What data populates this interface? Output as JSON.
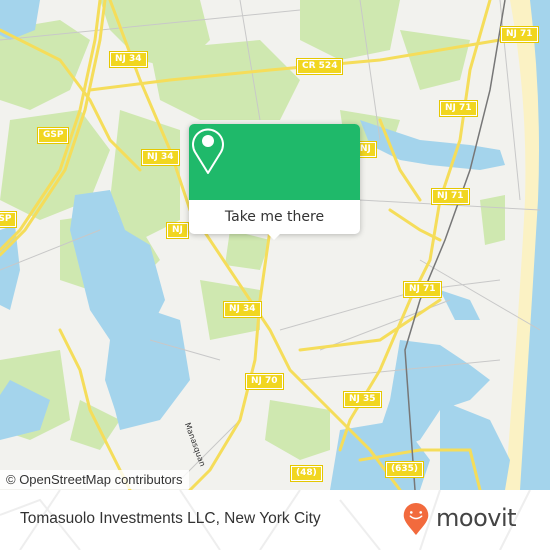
{
  "map": {
    "attribution": "© OpenStreetMap contributors",
    "colors": {
      "land": "#f2f2ee",
      "park": "#cfe8b0",
      "water": "#a4d4ec",
      "road_major": "#f5dd5a",
      "beach": "#fbf2c4",
      "accent": "#1fb96a"
    },
    "road_labels": [
      {
        "id": "nj71-top",
        "text": "NJ 71"
      },
      {
        "id": "cr524",
        "text": "CR 524"
      },
      {
        "id": "nj34-a",
        "text": "NJ 34"
      },
      {
        "id": "nj71-b",
        "text": "NJ 71"
      },
      {
        "id": "gsp",
        "text": "GSP"
      },
      {
        "id": "nj34-b",
        "text": "NJ 34"
      },
      {
        "id": "nj71-c",
        "text": "NJ 71"
      },
      {
        "id": "gsp-left",
        "text": "GSP"
      },
      {
        "id": "nj-left",
        "text": "NJ"
      },
      {
        "id": "nj71-d",
        "text": "NJ 71"
      },
      {
        "id": "nj34-c",
        "text": "NJ 34"
      },
      {
        "id": "nj70",
        "text": "NJ 70"
      },
      {
        "id": "nj35",
        "text": "NJ 35"
      },
      {
        "id": "r48",
        "text": "(48)"
      },
      {
        "id": "r635",
        "text": "(635)"
      },
      {
        "id": "nj-right",
        "text": "NJ"
      }
    ],
    "street_label": "Manasquan"
  },
  "popup": {
    "action_label": "Take me there",
    "icon": "location-pin-icon"
  },
  "footer": {
    "title": "Tomasuolo Investments LLC, New York City",
    "brand": "moovit",
    "brand_color": "#f26a3d"
  }
}
